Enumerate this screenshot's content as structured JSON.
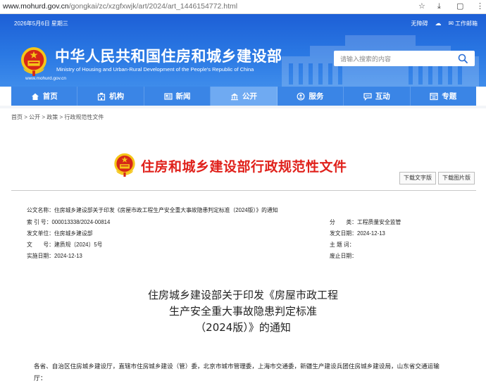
{
  "browser": {
    "url_host": "www.mohurd.gov.cn",
    "url_path": "/gongkai/zc/xzgfxwjk/art/2024/art_1446154772.html"
  },
  "header": {
    "date": "2026年5月6日 星期三",
    "links": [
      "无障碍",
      "微博",
      "工作邮箱"
    ],
    "title_cn": "中华人民共和国住房和城乡建设部",
    "title_en": "Ministry of Housing and Urban-Rural Development of the People's Republic of China",
    "site": "www.mohurd.gov.cn",
    "search_placeholder": "请输入搜索的内容"
  },
  "nav": {
    "items": [
      {
        "label": "首页",
        "icon": "home-icon"
      },
      {
        "label": "机构",
        "icon": "building-icon"
      },
      {
        "label": "新闻",
        "icon": "news-icon"
      },
      {
        "label": "公开",
        "icon": "open-gov-icon",
        "active": true
      },
      {
        "label": "服务",
        "icon": "service-icon"
      },
      {
        "label": "互动",
        "icon": "chat-icon"
      },
      {
        "label": "专题",
        "icon": "topic-icon"
      }
    ]
  },
  "breadcrumb": "首页 > 公开 > 政策 > 行政规范性文件",
  "doc": {
    "banner_title": "住房和城乡建设部行政规范性文件",
    "download_text": "下载文字版",
    "download_image": "下载图片版",
    "meta": {
      "title_label": "公文名称：",
      "title_value": "住房城乡建设部关于印发《房屋市政工程生产安全重大事故隐患判定标准（2024版）》的通知",
      "index_label": "索 引 号：",
      "index_value": "000013338/2024-00814",
      "category_label": "分　　类：",
      "category_value": "工程质量安全监管",
      "issuer_label": "发文单位：",
      "issuer_value": "住房城乡建设部",
      "date_label": "发文日期：",
      "date_value": "2024-12-13",
      "docno_label": "文　　号：",
      "docno_value": "建质规〔2024〕5号",
      "keyword_label": "主 题 词：",
      "keyword_value": "",
      "effective_label": "实施日期：",
      "effective_value": "2024-12-13",
      "abolish_label": "废止日期：",
      "abolish_value": ""
    },
    "heading_lines": [
      "住房城乡建设部关于印发《房屋市政工程",
      "生产安全重大事故隐患判定标准",
      "（2024版）》的通知"
    ],
    "body_line1": "各省、自治区住房城乡建设厅，直辖市住房城乡建设（管）委，北京市城市管理委，上海市交通委，新疆生产建设兵团住房城乡建设局，山东省交通运输",
    "body_line2": "厅："
  },
  "colors": {
    "header_blue": "#2a78e3",
    "nav_blue": "#3a85e6",
    "nav_active": "#6faaf2",
    "title_red": "#e0211b"
  }
}
